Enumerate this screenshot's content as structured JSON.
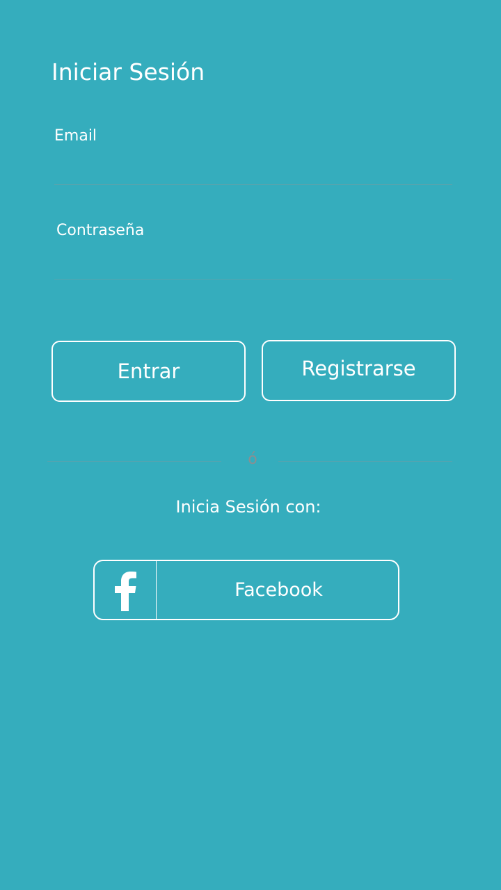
{
  "login": {
    "title": "Iniciar Sesión",
    "email_label": "Email",
    "email_value": "",
    "password_label": "Contraseña",
    "password_value": ""
  },
  "actions": {
    "enter_label": "Entrar",
    "register_label": "Registrarse"
  },
  "divider": {
    "text": "ó"
  },
  "social": {
    "caption": "Inicia Sesión con:",
    "facebook_label": "Facebook",
    "facebook_icon": "facebook-icon"
  },
  "colors": {
    "background": "#35adbd",
    "text": "#ffffff",
    "divider": "#5aa3ad"
  }
}
